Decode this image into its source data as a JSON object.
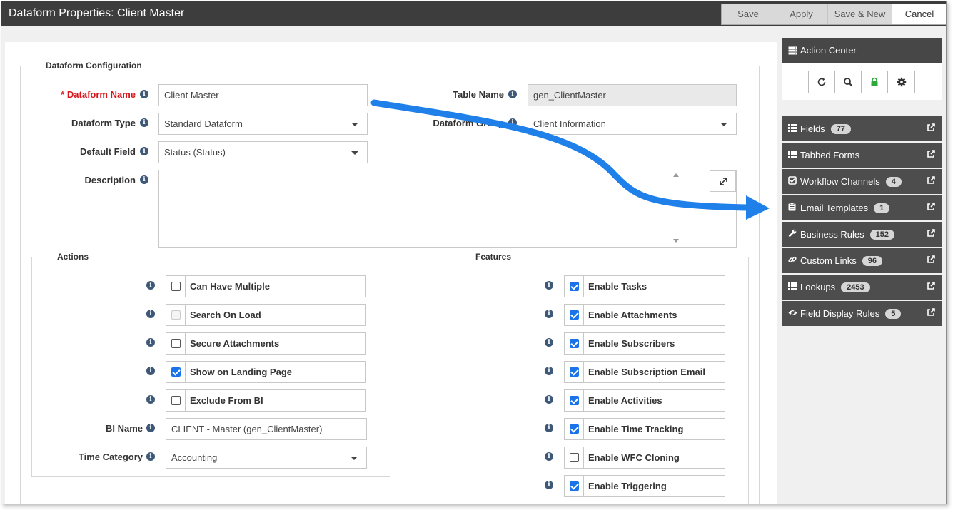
{
  "window": {
    "title": "Dataform Properties: Client Master",
    "buttons": {
      "save": "Save",
      "apply": "Apply",
      "save_new": "Save & New",
      "cancel": "Cancel"
    }
  },
  "config": {
    "legend": "Dataform Configuration",
    "dataform_name_label": "* Dataform Name",
    "dataform_name_value": "Client Master",
    "table_name_label": "Table Name",
    "table_name_value": "gen_ClientMaster",
    "dataform_type_label": "Dataform Type",
    "dataform_type_value": "Standard Dataform",
    "dataform_group_label": "Dataform Group",
    "dataform_group_value": "Client Information",
    "default_field_label": "Default Field",
    "default_field_value": "Status (Status)",
    "description_label": "Description",
    "description_value": ""
  },
  "actions": {
    "legend": "Actions",
    "items": [
      {
        "label": "Can Have Multiple",
        "checked": false,
        "disabled": false
      },
      {
        "label": "Search On Load",
        "checked": false,
        "disabled": true
      },
      {
        "label": "Secure Attachments",
        "checked": false,
        "disabled": false
      },
      {
        "label": "Show on Landing Page",
        "checked": true,
        "disabled": false
      },
      {
        "label": "Exclude From BI",
        "checked": false,
        "disabled": false
      }
    ],
    "bi_name_label": "BI Name",
    "bi_name_value": "CLIENT - Master (gen_ClientMaster)",
    "time_category_label": "Time Category",
    "time_category_value": "Accounting"
  },
  "features": {
    "legend": "Features",
    "items": [
      {
        "label": "Enable Tasks",
        "checked": true
      },
      {
        "label": "Enable Attachments",
        "checked": true
      },
      {
        "label": "Enable Subscribers",
        "checked": true
      },
      {
        "label": "Enable Subscription Email",
        "checked": true
      },
      {
        "label": "Enable Activities",
        "checked": true
      },
      {
        "label": "Enable Time Tracking",
        "checked": true
      },
      {
        "label": "Enable WFC Cloning",
        "checked": false
      },
      {
        "label": "Enable Triggering",
        "checked": true
      }
    ]
  },
  "action_center": {
    "title": "Action Center",
    "tools": [
      "refresh-icon",
      "search-icon",
      "lock-icon",
      "gear-icon"
    ],
    "items": [
      {
        "label": "Fields",
        "count": "77",
        "icon": "list-icon"
      },
      {
        "label": "Tabbed Forms",
        "count": "",
        "icon": "list-icon"
      },
      {
        "label": "Workflow Channels",
        "count": "4",
        "icon": "checkbox-icon"
      },
      {
        "label": "Email Templates",
        "count": "1",
        "icon": "clipboard-icon"
      },
      {
        "label": "Business Rules",
        "count": "152",
        "icon": "wrench-icon"
      },
      {
        "label": "Custom Links",
        "count": "96",
        "icon": "link-icon"
      },
      {
        "label": "Lookups",
        "count": "2453",
        "icon": "list-icon"
      },
      {
        "label": "Field Display Rules",
        "count": "5",
        "icon": "eye-icon"
      }
    ]
  },
  "colors": {
    "accent_blue": "#1a73e8",
    "arrow_blue": "#2a8ff0",
    "required_red": "#d9141a",
    "sidebar_dark": "#4d4d4d",
    "titlebar": "#3d3d3d",
    "lock_green": "#2eaa3c"
  }
}
